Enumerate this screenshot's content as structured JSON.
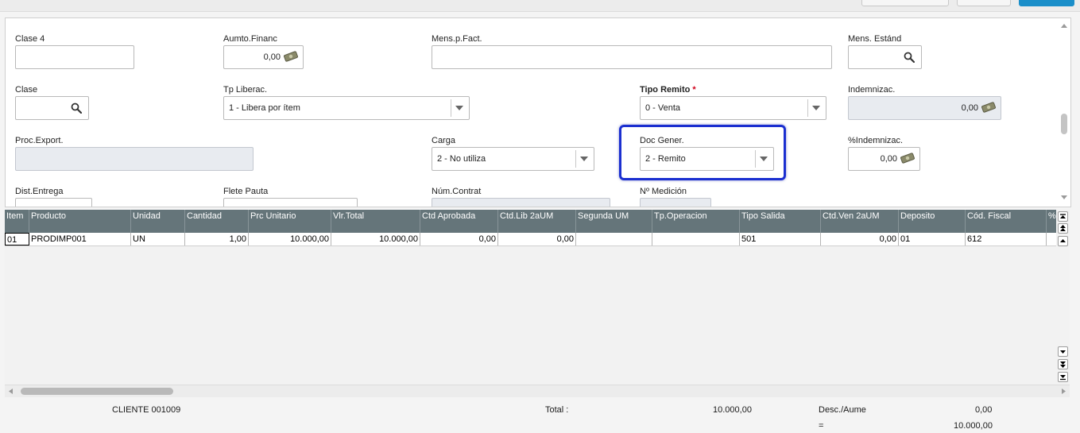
{
  "form": {
    "clase4": {
      "label": "Clase 4",
      "value": ""
    },
    "aumto_financ": {
      "label": "Aumto.Financ",
      "value": "0,00"
    },
    "mens_p_fact": {
      "label": "Mens.p.Fact.",
      "value": ""
    },
    "mens_estand": {
      "label": "Mens. Estánd",
      "value": ""
    },
    "clase": {
      "label": "Clase",
      "value": ""
    },
    "tp_liberac": {
      "label": "Tp Liberac.",
      "value": "1 - Libera por ítem"
    },
    "tipo_remito": {
      "label": "Tipo Remito",
      "required_mark": "*",
      "value": "0 - Venta"
    },
    "indemnizac": {
      "label": "Indemnizac.",
      "value": "0,00"
    },
    "proc_export": {
      "label": "Proc.Export.",
      "value": ""
    },
    "carga": {
      "label": "Carga",
      "value": "2 - No utiliza"
    },
    "doc_gener": {
      "label": "Doc Gener.",
      "value": "2 - Remito"
    },
    "pct_indemnizac": {
      "label": "%Indemnizac.",
      "value": "0,00"
    },
    "dist_entrega": {
      "label": "Dist.Entrega"
    },
    "flete_pauta": {
      "label": "Flete Pauta"
    },
    "num_contrat": {
      "label": "Núm.Contrat"
    },
    "num_medicion": {
      "label": "Nº Medición"
    }
  },
  "grid": {
    "columns": [
      "Item",
      "Producto",
      "Unidad",
      "Cantidad",
      "Prc Unitario",
      "Vlr.Total",
      "Ctd Aprobada",
      "Ctd.Lib 2aUM",
      "Segunda UM",
      "Tp.Operacion",
      "Tipo Salida",
      "Ctd.Ven 2aUM",
      "Deposito",
      "Cód. Fiscal",
      "%"
    ],
    "rows": [
      [
        "01",
        "PRODIMP001",
        "UN",
        "1,00",
        "10.000,00",
        "10.000,00",
        "0,00",
        "0,00",
        "",
        "",
        "501",
        "0,00",
        "01",
        "612",
        ""
      ]
    ]
  },
  "footer": {
    "cliente": "CLIENTE 001009",
    "total_label": "Total :",
    "total_value": "10.000,00",
    "desc_aume_label": "Desc./Aume",
    "desc_aume_value": "0,00",
    "equals_label": "=",
    "equals_value": "10.000,00"
  },
  "colors": {
    "grid_header": "#65757a",
    "highlight": "#1b2fd0",
    "required": "#d0021b",
    "accent_button": "#1a8ec9"
  },
  "icons": {
    "money": "money-icon",
    "search": "search-icon",
    "dropdown": "chevron-down-icon"
  }
}
